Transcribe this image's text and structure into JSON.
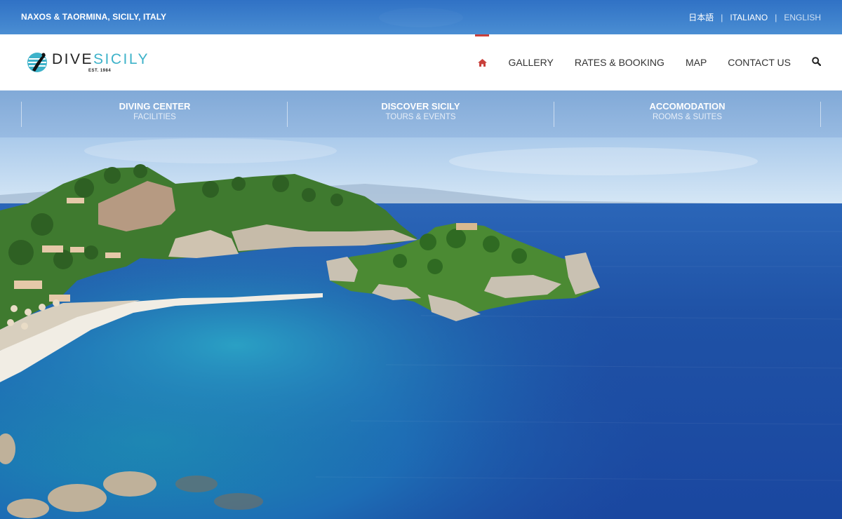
{
  "topbar": {
    "location": "NAXOS & TAORMINA, SICILY, ITALY",
    "languages": [
      "日本語",
      "ITALIANO",
      "ENGLISH"
    ],
    "separator": "|"
  },
  "logo": {
    "word_dive": "DIVE",
    "word_sicily": "SICILY",
    "est": "EST. 1984"
  },
  "nav": {
    "home_icon": "home-icon",
    "items": [
      "GALLERY",
      "RATES & BOOKING",
      "MAP",
      "CONTACT US"
    ],
    "search_icon": "search-icon",
    "accent_color": "#c9403b"
  },
  "categories": [
    {
      "title": "DIVING CENTER",
      "subtitle": "FACILITIES"
    },
    {
      "title": "DISCOVER SICILY",
      "subtitle": "TOURS & EVENTS"
    },
    {
      "title": "ACCOMODATION",
      "subtitle": "ROOMS & SUITES"
    }
  ],
  "hero": {
    "scene": "isola-bella-panorama"
  }
}
